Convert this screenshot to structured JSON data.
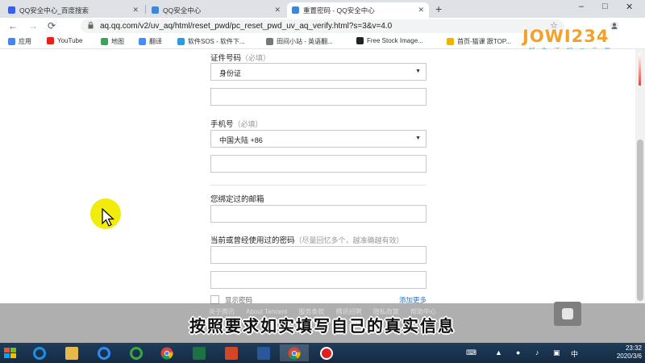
{
  "browser": {
    "tabs": [
      {
        "title": "QQ安全中心_百度搜索",
        "favicon_color": "#3a5ee6"
      },
      {
        "title": "QQ安全中心",
        "favicon_color": "#3f86d8"
      },
      {
        "title": "重置密码 - QQ安全中心",
        "favicon_color": "#3f86d8",
        "active": true
      }
    ],
    "new_tab_label": "+",
    "window_controls": [
      "–",
      "□",
      "✕"
    ],
    "nav": {
      "back": "←",
      "forward": "→",
      "reload": "⟳"
    },
    "url": "aq.qq.com/v2/uv_aq/html/reset_pwd/pc_reset_pwd_uv_aq_verify.html?s=3&v=4.0",
    "bookmarks": [
      {
        "label": "应用",
        "color": "#4285f4"
      },
      {
        "label": "YouTube",
        "color": "#e62117"
      },
      {
        "label": "地图",
        "color": "#34a853"
      },
      {
        "label": "翻译",
        "color": "#4a8af4"
      },
      {
        "label": "软件SOS - 软件下...",
        "color": "#2d9be0"
      },
      {
        "label": "田间小站 - 英语翻...",
        "color": "#777777"
      },
      {
        "label": "Free Stock Image...",
        "color": "#222222"
      },
      {
        "label": "首页-猫课 跟TOP...",
        "color": "#f2b300"
      }
    ]
  },
  "logo": {
    "brand": "JOWI234",
    "slogan": "好 生 活 好 二 三 四"
  },
  "form": {
    "id_label": "证件号码",
    "id_hint": "（必填）",
    "id_type": "身份证",
    "phone_label": "手机号",
    "phone_hint": "（必填）",
    "phone_region": "中国大陆 +86",
    "email_label": "您绑定过的邮箱",
    "password_label": "当前或曾经使用过的密码",
    "password_hint": "（尽量回忆多个，越准确越有效）",
    "show_password": "显示密码",
    "add_more": "添加更多"
  },
  "footer_links": [
    "关于腾讯",
    "About Tencent",
    "服务条款",
    "腾讯招聘",
    "隐私政策",
    "帮助中心"
  ],
  "caption": "按照要求如实填写自己的真实信息",
  "taskbar": {
    "apps": [
      {
        "name": "ie-icon",
        "color": "#1f8fe0"
      },
      {
        "name": "explorer-icon",
        "color": "#e8b84a"
      },
      {
        "name": "baidu-netdisk-icon",
        "color": "#2f8bf0"
      },
      {
        "name": "ie-alt-icon",
        "color": "#3aa846"
      },
      {
        "name": "chrome-icon",
        "color": "#db4437"
      },
      {
        "name": "excel-icon",
        "color": "#1d7144"
      },
      {
        "name": "powerpoint-icon",
        "color": "#d24726"
      },
      {
        "name": "word-icon",
        "color": "#2b579a"
      },
      {
        "name": "chrome-active-icon",
        "color": "#db4437"
      },
      {
        "name": "recorder-icon",
        "color": "#e02020"
      }
    ],
    "ime": "中",
    "date": "2020/3/6",
    "time": "23:32"
  },
  "colors": {
    "link": "#2b76c2",
    "taskbar": "#1e3c5a",
    "cursor_highlight": "#f2ec0d"
  }
}
